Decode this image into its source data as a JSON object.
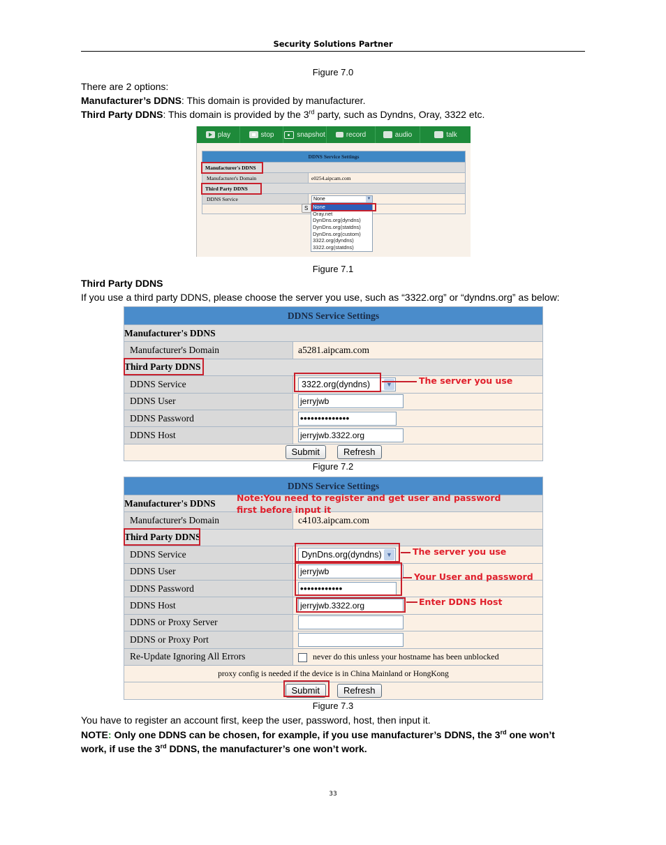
{
  "header": {
    "running_title": "Security Solutions Partner"
  },
  "captions": {
    "fig70": "Figure 7.0",
    "fig71": "Figure 7.1",
    "fig72": "Figure 7.2",
    "fig73": "Figure 7.3"
  },
  "intro": {
    "options_line": "There are 2 options:",
    "manufacturer_term": "Manufacturer’s DDNS",
    "manufacturer_desc": ": This domain is provided by manufacturer.",
    "third_term": "Third Party DDNS",
    "third_desc_a": ": This domain is provided by the 3",
    "third_desc_sup": "rd",
    "third_desc_b": " party, such as Dyndns, Oray, 3322 etc."
  },
  "fig71": {
    "toolbar": [
      {
        "label": "play",
        "icon": "play-icon"
      },
      {
        "label": "stop",
        "icon": "stop-icon"
      },
      {
        "label": "snapshot",
        "icon": "camera-icon"
      },
      {
        "label": "record",
        "icon": "record-icon"
      },
      {
        "label": "audio",
        "icon": "headphones-icon"
      },
      {
        "label": "talk",
        "icon": "microphone-icon"
      }
    ],
    "table_title": "DDNS Service Settings",
    "manufacturer_section": "Manufacturer's DDNS",
    "manufacturer_domain_label": "Manufacturer's Domain",
    "manufacturer_domain_value": "e0254.aipcam.com",
    "third_section": "Third Party DDNS",
    "service_label": "DDNS Service",
    "service_value": "None",
    "partial_button": "S",
    "dropdown_options": [
      "None",
      "Oray.net",
      "DynDns.org(dyndns)",
      "DynDns.org(statdns)",
      "DynDns.org(custom)",
      "3322.org(dyndns)",
      "3322.org(statdns)"
    ],
    "dropdown_selected": "None"
  },
  "section_third": {
    "heading": "Third Party DDNS",
    "body": "If you use a third party DDNS, please choose the server you use, such as “3322.org” or “dyndns.org” as below:"
  },
  "fig72": {
    "table_title": "DDNS Service Settings",
    "manufacturer_section": "Manufacturer's DDNS",
    "manufacturer_domain_label": "Manufacturer's Domain",
    "manufacturer_domain_value": "a5281.aipcam.com",
    "third_section": "Third Party DDNS",
    "service_label": "DDNS Service",
    "service_value": "3322.org(dyndns)",
    "user_label": "DDNS User",
    "user_value": "jerryjwb",
    "password_label": "DDNS Password",
    "password_value": "••••••••••••••",
    "host_label": "DDNS Host",
    "host_value": "jerryjwb.3322.org",
    "submit": "Submit",
    "refresh": "Refresh",
    "annotation_server": "The server you use"
  },
  "fig73": {
    "table_title": "DDNS Service Settings",
    "manufacturer_section": "Manufacturer's DDNS",
    "note_line1": "Note:You need to register and get user and password",
    "note_line2": "first before input it",
    "manufacturer_domain_label": "Manufacturer's Domain",
    "manufacturer_domain_value": "c4103.aipcam.com",
    "third_section": "Third Party DDNS",
    "service_label": "DDNS Service",
    "service_value": "DynDns.org(dyndns)",
    "user_label": "DDNS User",
    "user_value": "jerryjwb",
    "password_label": "DDNS Password",
    "password_value": "••••••••••••",
    "host_label": "DDNS Host",
    "host_value": "jerryjwb.3322.org",
    "proxy_server_label": "DDNS or Proxy Server",
    "proxy_server_value": "",
    "proxy_port_label": "DDNS or Proxy Port",
    "proxy_port_value": "",
    "reupdate_label": "Re-Update Ignoring All Errors",
    "reupdate_checked": false,
    "reupdate_hint": "never do this unless your hostname has been unblocked",
    "proxy_note": "proxy config is needed if the device is in China Mainland or HongKong",
    "submit": "Submit",
    "refresh": "Refresh",
    "annotation_server": "The server you use",
    "annotation_user_pw": "Your User and password",
    "annotation_host": "Enter DDNS Host"
  },
  "closing": {
    "register_line": "You have to register an account first, keep the user, password, host, then input it.",
    "note_label": "NOTE",
    "note_colon": ":",
    "note_a": " Only one DDNS can be chosen, for example, if you use manufacturer’s DDNS, the 3",
    "note_sup1": "rd",
    "note_b": " one won’t",
    "note_c": "work, if use the 3",
    "note_sup2": "rd",
    "note_d": " DDNS, the manufacturer’s one won’t work."
  },
  "footer": {
    "page_number": "33"
  }
}
